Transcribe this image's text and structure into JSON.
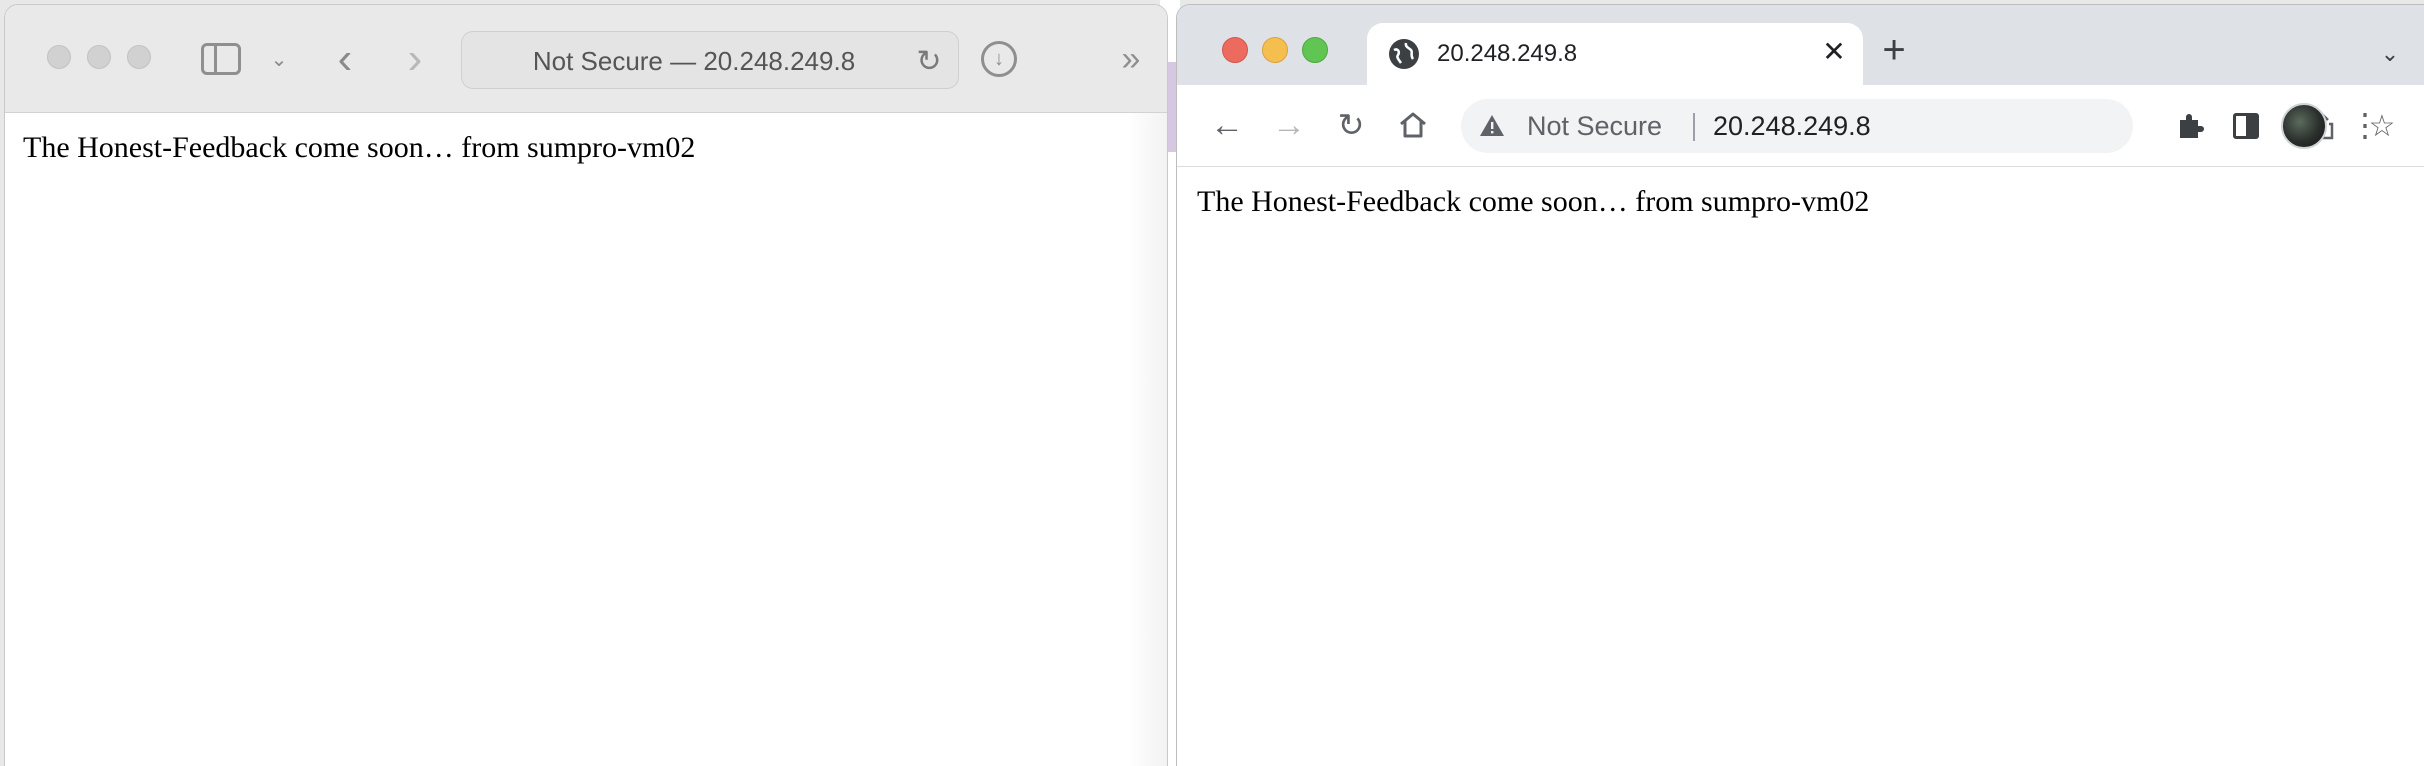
{
  "safari": {
    "address_text": "Not Secure — 20.248.249.8",
    "page_text": "The Honest-Feedback come soon… from sumpro-vm02"
  },
  "chrome": {
    "tab_title": "20.248.249.8",
    "not_secure_label": "Not Secure",
    "url": "20.248.249.8",
    "page_text": "The Honest-Feedback come soon… from sumpro-vm02"
  },
  "icons": {
    "safari": [
      "sidebar-icon",
      "chevron-down-icon",
      "back-icon",
      "forward-icon",
      "reload-icon",
      "download-icon",
      "more-icon"
    ],
    "chrome": [
      "globe-icon",
      "close-icon",
      "plus-icon",
      "tab-search-icon",
      "back-icon",
      "forward-icon",
      "reload-icon",
      "home-icon",
      "warning-icon",
      "share-icon",
      "star-icon",
      "extensions-icon",
      "side-panel-icon",
      "avatar",
      "menu-icon"
    ]
  },
  "colors": {
    "close": "#ed6a5e",
    "minimize": "#f5bf4f",
    "zoom": "#61c554",
    "inactive_traffic": "#d1d1d1"
  }
}
